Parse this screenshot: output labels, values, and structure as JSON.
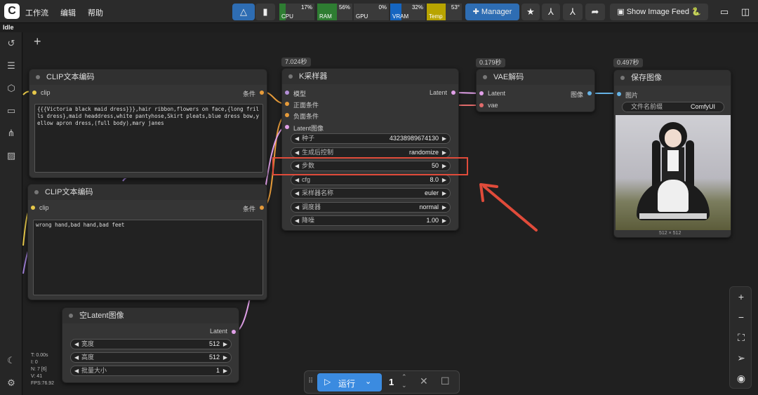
{
  "topbar": {
    "logo": "C",
    "menu": [
      "工作流",
      "编辑",
      "帮助"
    ],
    "monitors": [
      {
        "label": "CPU",
        "percent": "17%",
        "color": "#2e7d32",
        "level": 0.17
      },
      {
        "label": "RAM",
        "percent": "56%",
        "color": "#2e7d32",
        "level": 0.56
      },
      {
        "label": "GPU",
        "percent": "0%",
        "color": "#2e7d32",
        "level": 0.0
      },
      {
        "label": "VRAM",
        "percent": "32%",
        "color": "#1565c0",
        "level": 0.32
      },
      {
        "label": "Temp",
        "percent": "53°",
        "color": "#b8a400",
        "level": 0.53
      }
    ],
    "manager_label": "Manager",
    "image_feed_label": "Show Image Feed 🐍"
  },
  "status": "Idle",
  "nodes": {
    "clip1": {
      "title": "CLIP文本编码",
      "in_port": "clip",
      "out_port": "条件",
      "text": "{{{Victoria black maid dress}}},hair ribbon,flowers on face,{long frills dress},maid headdress,white pantyhose,Skirt pleats,blue dress bow,yellow apron dress,(full body),mary janes"
    },
    "clip2": {
      "title": "CLIP文本编码",
      "in_port": "clip",
      "out_port": "条件",
      "text": "wrong hand,bad hand,bad feet"
    },
    "latent": {
      "title": "空Latent图像",
      "out_port": "Latent",
      "widgets": [
        {
          "label": "宽度",
          "value": "512"
        },
        {
          "label": "高度",
          "value": "512"
        },
        {
          "label": "批量大小",
          "value": "1"
        }
      ]
    },
    "ksampler": {
      "title": "K采样器",
      "badge": "7.024秒",
      "inputs": [
        "模型",
        "正面条件",
        "负面条件",
        "Latent图像"
      ],
      "output": "Latent",
      "widgets": [
        {
          "label": "种子",
          "value": "43238989674130"
        },
        {
          "label": "生成后控制",
          "value": "randomize"
        },
        {
          "label": "步数",
          "value": "50"
        },
        {
          "label": "cfg",
          "value": "8.0"
        },
        {
          "label": "采样器名称",
          "value": "euler"
        },
        {
          "label": "调度器",
          "value": "normal"
        },
        {
          "label": "降噪",
          "value": "1.00"
        }
      ]
    },
    "vae": {
      "title": "VAE解码",
      "badge": "0.179秒",
      "inputs": [
        "Latent",
        "vae"
      ],
      "output": "图像"
    },
    "save": {
      "title": "保存图像",
      "badge": "0.497秒",
      "input": "图片",
      "prefix_label": "文件名前缀",
      "prefix_value": "ComfyUI",
      "size": "512 × 512"
    }
  },
  "stats": [
    "T: 0.00s",
    "I: 0",
    "N: 7 [6]",
    "V: 41",
    "FPS:76.92"
  ],
  "runbar": {
    "run_label": "运行",
    "count": "1"
  }
}
